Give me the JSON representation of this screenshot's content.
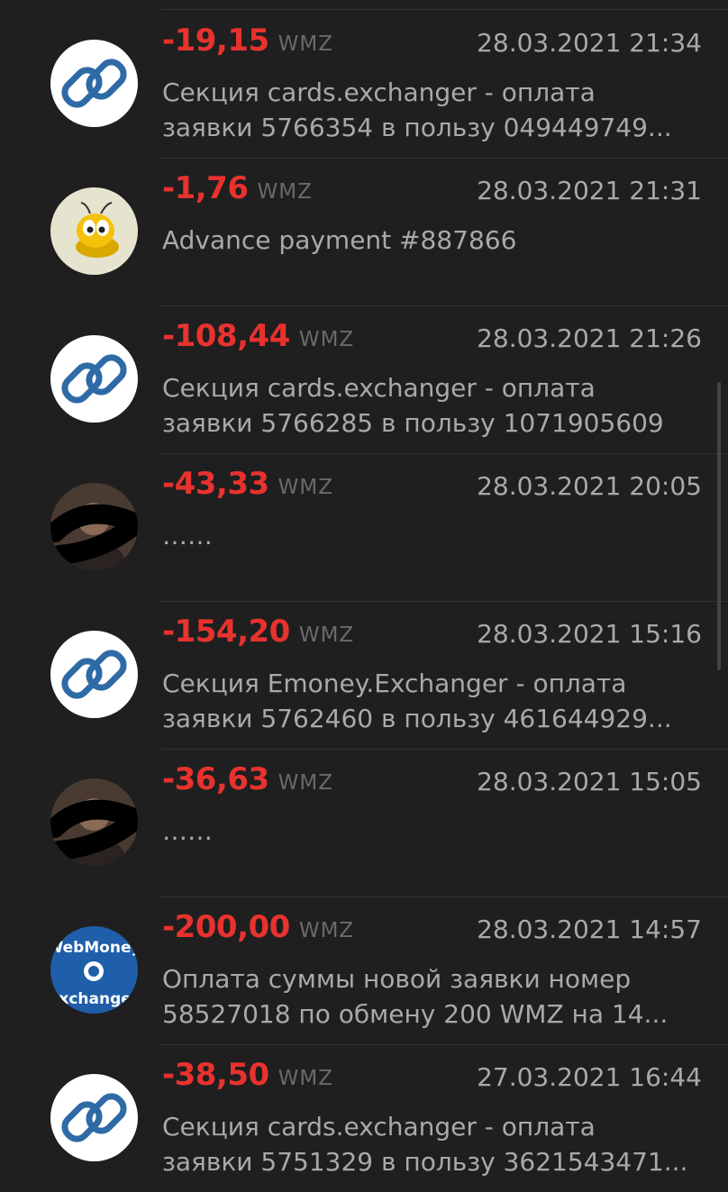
{
  "transactions": [
    {
      "amount": "-19,15",
      "currency": "WMZ",
      "date": "28.03.2021 21:34",
      "line1": "Секция cards.exchanger - оплата",
      "line2": "заявки 5766354 в пользу 049449749...",
      "avatar": "exchanger-link-icon"
    },
    {
      "amount": "-1,76",
      "currency": "WMZ",
      "date": "28.03.2021 21:31",
      "line1": "Advance payment #887866",
      "line2": "",
      "avatar": "bee-icon"
    },
    {
      "amount": "-108,44",
      "currency": "WMZ",
      "date": "28.03.2021 21:26",
      "line1": "Секция cards.exchanger - оплата",
      "line2": "заявки 5766285 в пользу 1071905609",
      "avatar": "exchanger-link-icon"
    },
    {
      "amount": "-43,33",
      "currency": "WMZ",
      "date": "28.03.2021 20:05",
      "line1": "……",
      "line2": "",
      "avatar": "user-photo"
    },
    {
      "amount": "-154,20",
      "currency": "WMZ",
      "date": "28.03.2021 15:16",
      "line1": "Секция Emoney.Exchanger - оплата",
      "line2": "заявки 5762460 в пользу 461644929...",
      "avatar": "exchanger-link-icon"
    },
    {
      "amount": "-36,63",
      "currency": "WMZ",
      "date": "28.03.2021 15:05",
      "line1": "……",
      "line2": "",
      "avatar": "user-photo"
    },
    {
      "amount": "-200,00",
      "currency": "WMZ",
      "date": "28.03.2021 14:57",
      "line1": "Оплата суммы новой заявки номер",
      "line2": "58527018 по обмену 200 WMZ на 14...",
      "avatar": "webmoney-exchanger-logo"
    },
    {
      "amount": "-38,50",
      "currency": "WMZ",
      "date": "27.03.2021 16:44",
      "line1": "Секция cards.exchanger - оплата",
      "line2": "заявки 5751329 в пользу 3621543471...",
      "avatar": "exchanger-link-icon"
    }
  ],
  "colors": {
    "background": "#1f1f1f",
    "amount": "#e8322e",
    "text": "#a9a9a9",
    "currency": "#6a6a6a",
    "link_icon_blue": "#2e6aa6"
  },
  "logo_text": {
    "top": "WebMoney",
    "bottom": "exchanger"
  }
}
